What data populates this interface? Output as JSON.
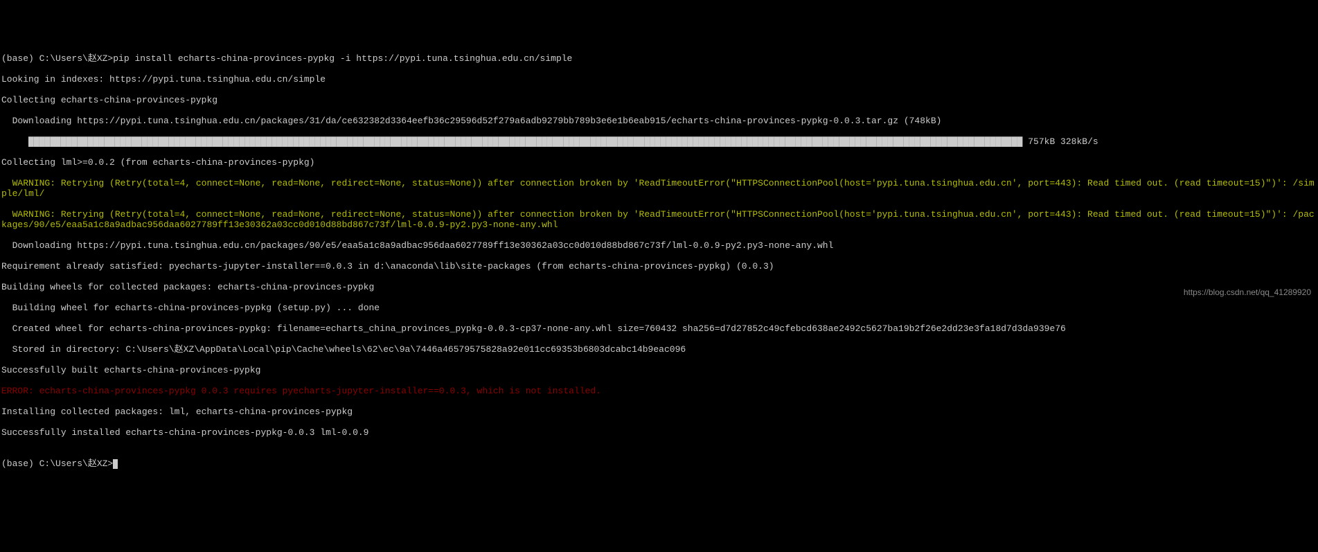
{
  "prompt1_prefix": "(base) C:\\Users\\赵XZ>",
  "prompt1_cmd": "pip install echarts-china-provinces-pypkg -i https://pypi.tuna.tsinghua.edu.cn/simple",
  "line_indexes": "Looking in indexes: https://pypi.tuna.tsinghua.edu.cn/simple",
  "line_collect1": "Collecting echarts-china-provinces-pypkg",
  "line_download1": "  Downloading https://pypi.tuna.tsinghua.edu.cn/packages/31/da/ce632382d3364eefb36c29596d52f279a6adb9279bb789b3e6e1b6eab915/echarts-china-provinces-pypkg-0.0.3.tar.gz (748kB)",
  "progress_prefix": "     ",
  "progress_bar": "████████████████████████████████████████████████████████████████████████████████████████████████████████████████████████████████████████████████████████████████████████████████████████",
  "progress_text": " 757kB 328kB/s",
  "line_collect2": "Collecting lml>=0.0.2 (from echarts-china-provinces-pypkg)",
  "warn1": "  WARNING: Retrying (Retry(total=4, connect=None, read=None, redirect=None, status=None)) after connection broken by 'ReadTimeoutError(\"HTTPSConnectionPool(host='pypi.tuna.tsinghua.edu.cn', port=443): Read timed out. (read timeout=15)\")': /simple/lml/",
  "warn2": "  WARNING: Retrying (Retry(total=4, connect=None, read=None, redirect=None, status=None)) after connection broken by 'ReadTimeoutError(\"HTTPSConnectionPool(host='pypi.tuna.tsinghua.edu.cn', port=443): Read timed out. (read timeout=15)\")': /packages/90/e5/eaa5a1c8a9adbac956daa6027789ff13e30362a03cc0d010d88bd867c73f/lml-0.0.9-py2.py3-none-any.whl",
  "line_download2": "  Downloading https://pypi.tuna.tsinghua.edu.cn/packages/90/e5/eaa5a1c8a9adbac956daa6027789ff13e30362a03cc0d010d88bd867c73f/lml-0.0.9-py2.py3-none-any.whl",
  "line_req": "Requirement already satisfied: pyecharts-jupyter-installer==0.0.3 in d:\\anaconda\\lib\\site-packages (from echarts-china-provinces-pypkg) (0.0.3)",
  "line_build1": "Building wheels for collected packages: echarts-china-provinces-pypkg",
  "line_build2": "  Building wheel for echarts-china-provinces-pypkg (setup.py) ... done",
  "line_created": "  Created wheel for echarts-china-provinces-pypkg: filename=echarts_china_provinces_pypkg-0.0.3-cp37-none-any.whl size=760432 sha256=d7d27852c49cfebcd638ae2492c5627ba19b2f26e2dd23e3fa18d7d3da939e76",
  "line_stored": "  Stored in directory: C:\\Users\\赵XZ\\AppData\\Local\\pip\\Cache\\wheels\\62\\ec\\9a\\7446a46579575828a92e011cc69353b6803dcabc14b9eac096",
  "line_built": "Successfully built echarts-china-provinces-pypkg",
  "error1": "ERROR: echarts-china-provinces-pypkg 0.0.3 requires pyecharts-jupyter-installer==0.0.3, which is not installed.",
  "line_install": "Installing collected packages: lml, echarts-china-provinces-pypkg",
  "line_success": "Successfully installed echarts-china-provinces-pypkg-0.0.3 lml-0.0.9",
  "blank": "",
  "prompt2": "(base) C:\\Users\\赵XZ>",
  "watermark": "https://blog.csdn.net/qq_41289920"
}
